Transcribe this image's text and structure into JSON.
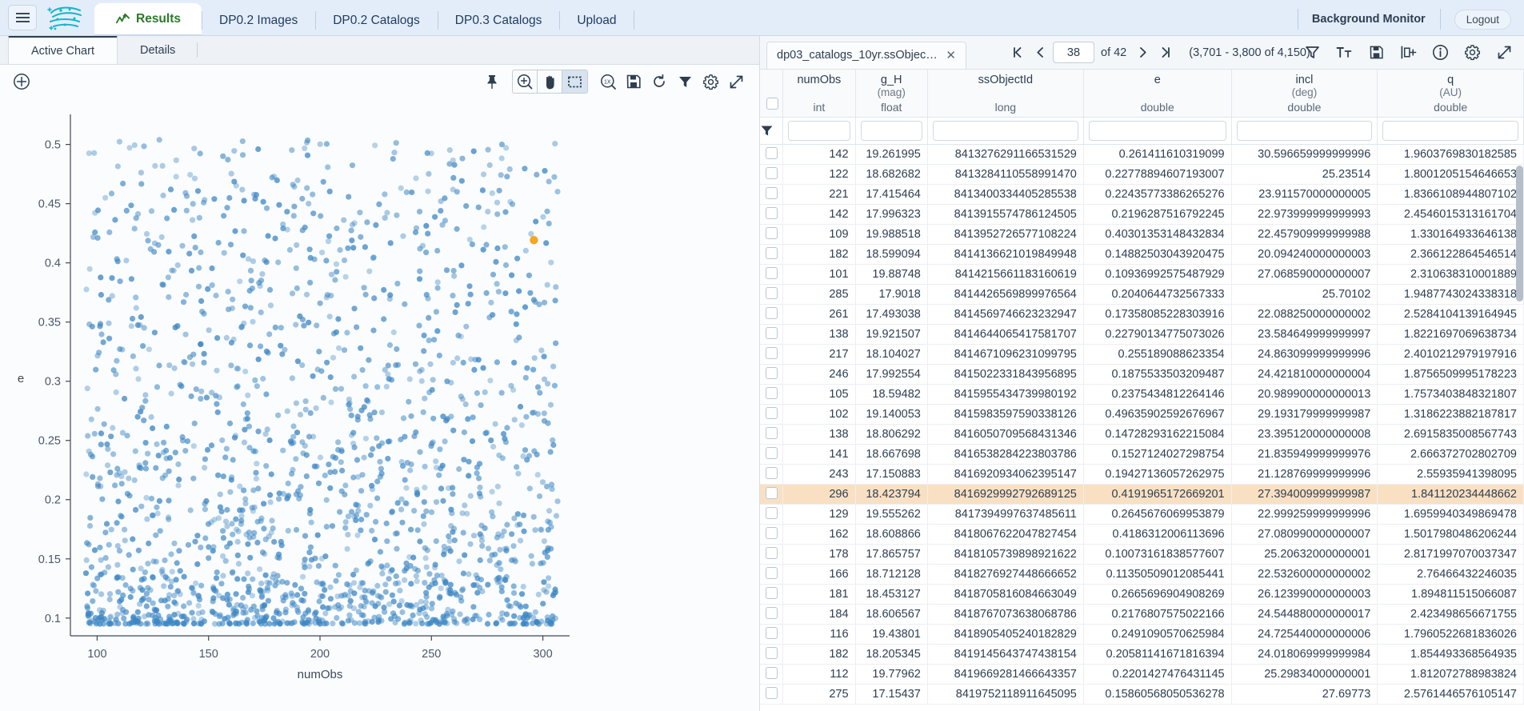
{
  "topbar": {
    "menu_icon": "hamburger-icon",
    "logo_icon": "rubin-logo-icon",
    "tabs": [
      {
        "label": "Results",
        "icon": "chart-line-icon",
        "active": true
      },
      {
        "label": "DP0.2 Images",
        "active": false
      },
      {
        "label": "DP0.2 Catalogs",
        "active": false
      },
      {
        "label": "DP0.3 Catalogs",
        "active": false
      },
      {
        "label": "Upload",
        "active": false
      }
    ],
    "background_monitor": "Background Monitor",
    "logout": "Logout"
  },
  "chart_panel": {
    "tabs": [
      {
        "label": "Active Chart",
        "active": true
      },
      {
        "label": "Details",
        "active": false
      }
    ],
    "add_icon": "add-circle-icon",
    "tools": [
      {
        "name": "pin-icon",
        "selected": false
      },
      {
        "name": "zoom-in-icon",
        "selected": false
      },
      {
        "name": "pan-hand-icon",
        "selected": false
      },
      {
        "name": "select-box-icon",
        "selected": true
      },
      {
        "name": "zoom-reset-1x-icon",
        "selected": false
      },
      {
        "name": "save-disk-icon",
        "selected": false
      },
      {
        "name": "restore-refresh-icon",
        "selected": false
      },
      {
        "name": "filter-icon",
        "selected": false
      },
      {
        "name": "settings-gear-icon",
        "selected": false
      },
      {
        "name": "expand-icon",
        "selected": false
      }
    ]
  },
  "chart_data": {
    "type": "scatter",
    "title": "",
    "xlabel": "numObs",
    "ylabel": "e",
    "xlim": [
      88,
      312
    ],
    "ylim": [
      0.085,
      0.52
    ],
    "xticks": [
      100,
      150,
      200,
      250,
      300
    ],
    "yticks": [
      0.1,
      0.15,
      0.2,
      0.25,
      0.3,
      0.35,
      0.4,
      0.45,
      0.5
    ],
    "grid": false,
    "legend": "none",
    "point_color": "#3d87c4",
    "point_opacity": 0.55,
    "point_radius": 3.6,
    "n_points": 1800,
    "density_note": "Dense cloud densest at low e (0.10-0.22) across full numObs range; sparse above e=0.35",
    "highlight_point": {
      "x": 296,
      "y": 0.4192,
      "color": "#f5a623",
      "label": "selected-row-point"
    },
    "series": [
      {
        "name": "ssObject",
        "x_range": [
          95,
          305
        ],
        "y_range": [
          0.09,
          0.5
        ]
      }
    ]
  },
  "table_panel": {
    "tab_label": "dp03_catalogs_10yr.ssObject...",
    "close_icon": "close-icon",
    "pager": {
      "first_icon": "first-page-icon",
      "prev_icon": "prev-page-icon",
      "page_value": "38",
      "of_label": "of 42",
      "next_icon": "next-page-icon",
      "last_icon": "last-page-icon",
      "range_label": "(3,701 - 3,800 of 4,150)"
    },
    "tools": [
      {
        "name": "filter-icon"
      },
      {
        "name": "text-size-icon"
      },
      {
        "name": "save-icon"
      },
      {
        "name": "add-column-icon"
      },
      {
        "name": "info-icon"
      },
      {
        "name": "settings-gear-icon"
      },
      {
        "name": "expand-icon"
      }
    ],
    "filter_row_icon": "funnel-icon",
    "columns": [
      {
        "name": "numObs",
        "unit": "",
        "type": "int",
        "width": 88
      },
      {
        "name": "g_H",
        "unit": "(mag)",
        "type": "float",
        "width": 88
      },
      {
        "name": "ssObjectId",
        "unit": "",
        "type": "long",
        "width": 190
      },
      {
        "name": "e",
        "unit": "",
        "type": "double",
        "width": 180
      },
      {
        "name": "incl",
        "unit": "(deg)",
        "type": "double",
        "width": 178
      },
      {
        "name": "q",
        "unit": "(AU)",
        "type": "double",
        "width": 178
      }
    ],
    "rows": [
      {
        "numObs": "142",
        "g_H": "19.261995",
        "ssObjectId": "8413276291166531529",
        "e": "0.261411610319099",
        "incl": "30.596659999999996",
        "q": "1.9603769830182585",
        "highlight": false
      },
      {
        "numObs": "122",
        "g_H": "18.682682",
        "ssObjectId": "8413284110558991470",
        "e": "0.22778894607193007",
        "incl": "25.23514",
        "q": "1.8001205154646653",
        "highlight": false
      },
      {
        "numObs": "221",
        "g_H": "17.415464",
        "ssObjectId": "8413400334405285538",
        "e": "0.22435773386265276",
        "incl": "23.911570000000005",
        "q": "1.8366108944807102",
        "highlight": false
      },
      {
        "numObs": "142",
        "g_H": "17.996323",
        "ssObjectId": "8413915574786124505",
        "e": "0.2196287516792245",
        "incl": "22.973999999999993",
        "q": "2.4546015313161704",
        "highlight": false
      },
      {
        "numObs": "109",
        "g_H": "19.988518",
        "ssObjectId": "8413952726577108224",
        "e": "0.40301353148432834",
        "incl": "22.457909999999988",
        "q": "1.330164933646138",
        "highlight": false
      },
      {
        "numObs": "182",
        "g_H": "18.599094",
        "ssObjectId": "8414136621019849948",
        "e": "0.14882503043920475",
        "incl": "20.094240000000003",
        "q": "2.366122864546514",
        "highlight": false
      },
      {
        "numObs": "101",
        "g_H": "19.88748",
        "ssObjectId": "8414215661183160619",
        "e": "0.10936992575487929",
        "incl": "27.068590000000007",
        "q": "2.310638310001889",
        "highlight": false
      },
      {
        "numObs": "285",
        "g_H": "17.9018",
        "ssObjectId": "8414426569899976564",
        "e": "0.2040644732567333",
        "incl": "25.70102",
        "q": "1.9487743024338318",
        "highlight": false
      },
      {
        "numObs": "261",
        "g_H": "17.493038",
        "ssObjectId": "8414569746623232947",
        "e": "0.17358085228303916",
        "incl": "22.088250000000002",
        "q": "2.5284104139164945",
        "highlight": false
      },
      {
        "numObs": "138",
        "g_H": "19.921507",
        "ssObjectId": "8414644065417581707",
        "e": "0.22790134775073026",
        "incl": "23.584649999999997",
        "q": "1.8221697069638734",
        "highlight": false
      },
      {
        "numObs": "217",
        "g_H": "18.104027",
        "ssObjectId": "8414671096231099795",
        "e": "0.255189088623354",
        "incl": "24.863099999999996",
        "q": "2.4010212979197916",
        "highlight": false
      },
      {
        "numObs": "246",
        "g_H": "17.992554",
        "ssObjectId": "8415022331843956895",
        "e": "0.1875533503209487",
        "incl": "24.421810000000004",
        "q": "1.8756509995178223",
        "highlight": false
      },
      {
        "numObs": "105",
        "g_H": "18.59482",
        "ssObjectId": "8415955434739980192",
        "e": "0.2375434812264146",
        "incl": "20.989900000000013",
        "q": "1.7573403848321807",
        "highlight": false
      },
      {
        "numObs": "102",
        "g_H": "19.140053",
        "ssObjectId": "8415983597590338126",
        "e": "0.49635902592676967",
        "incl": "29.193179999999987",
        "q": "1.3186223882187817",
        "highlight": false
      },
      {
        "numObs": "138",
        "g_H": "18.806292",
        "ssObjectId": "8416050709568431346",
        "e": "0.14728293162215084",
        "incl": "23.395120000000008",
        "q": "2.6915835008567743",
        "highlight": false
      },
      {
        "numObs": "141",
        "g_H": "18.667698",
        "ssObjectId": "8416538284223803786",
        "e": "0.1527124027298754",
        "incl": "21.835949999999976",
        "q": "2.666372702802709",
        "highlight": false
      },
      {
        "numObs": "243",
        "g_H": "17.150883",
        "ssObjectId": "8416920934062395147",
        "e": "0.19427136057262975",
        "incl": "21.128769999999996",
        "q": "2.55935941398095",
        "highlight": false
      },
      {
        "numObs": "296",
        "g_H": "18.423794",
        "ssObjectId": "8416929992792689125",
        "e": "0.4191965172669201",
        "incl": "27.394009999999987",
        "q": "1.841120234448662",
        "highlight": true
      },
      {
        "numObs": "129",
        "g_H": "19.555262",
        "ssObjectId": "8417394997637485611",
        "e": "0.2645676069953879",
        "incl": "22.999259999999996",
        "q": "1.6959940349869478",
        "highlight": false
      },
      {
        "numObs": "162",
        "g_H": "18.608866",
        "ssObjectId": "8418067622047827454",
        "e": "0.4186312006113696",
        "incl": "27.080990000000007",
        "q": "1.5017980486206244",
        "highlight": false
      },
      {
        "numObs": "178",
        "g_H": "17.865757",
        "ssObjectId": "8418105739898921622",
        "e": "0.10073161838577607",
        "incl": "25.20632000000001",
        "q": "2.8171997070037347",
        "highlight": false
      },
      {
        "numObs": "166",
        "g_H": "18.712128",
        "ssObjectId": "8418276927448666652",
        "e": "0.11350509012085441",
        "incl": "22.532600000000002",
        "q": "2.76466432246035",
        "highlight": false
      },
      {
        "numObs": "181",
        "g_H": "18.453127",
        "ssObjectId": "8418705816084663049",
        "e": "0.2665696904908269",
        "incl": "26.123990000000003",
        "q": "1.894811515066087",
        "highlight": false
      },
      {
        "numObs": "184",
        "g_H": "18.606567",
        "ssObjectId": "8418767073638068786",
        "e": "0.2176807575022166",
        "incl": "24.544880000000017",
        "q": "2.423498656671755",
        "highlight": false
      },
      {
        "numObs": "116",
        "g_H": "19.43801",
        "ssObjectId": "8418905405240182829",
        "e": "0.2491090570625984",
        "incl": "24.725440000000006",
        "q": "1.7960522681836026",
        "highlight": false
      },
      {
        "numObs": "182",
        "g_H": "18.205345",
        "ssObjectId": "8419145643747438154",
        "e": "0.20581141671816394",
        "incl": "24.018069999999984",
        "q": "1.854493368564935",
        "highlight": false
      },
      {
        "numObs": "112",
        "g_H": "19.77962",
        "ssObjectId": "8419669281466643357",
        "e": "0.2201427476431145",
        "incl": "25.29834000000001",
        "q": "1.812072788983824",
        "highlight": false
      },
      {
        "numObs": "275",
        "g_H": "17.15437",
        "ssObjectId": "8419752118911645095",
        "e": "0.15860568050536278",
        "incl": "27.69773",
        "q": "2.5761446576105147",
        "highlight": false
      }
    ]
  }
}
